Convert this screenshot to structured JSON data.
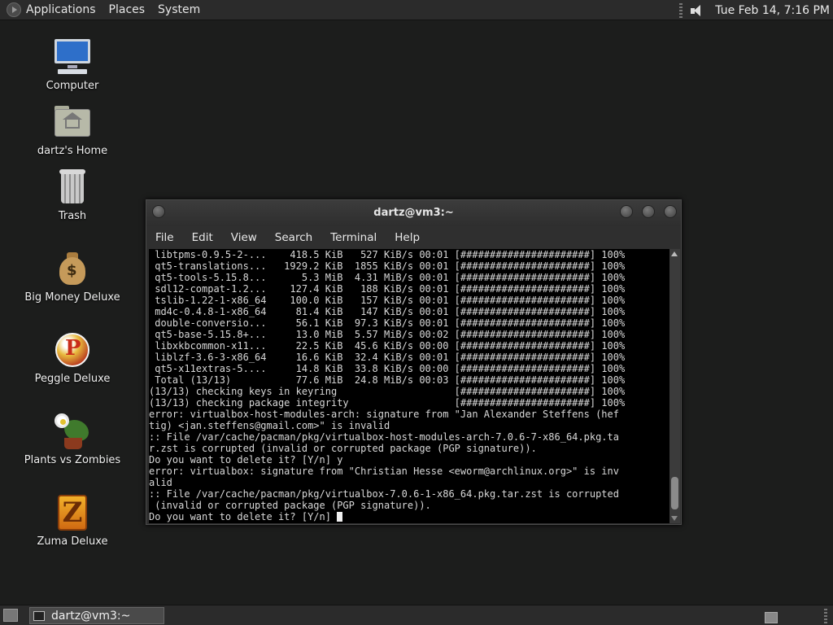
{
  "top_panel": {
    "menus": [
      "Applications",
      "Places",
      "System"
    ],
    "clock": "Tue Feb 14,  7:16 PM"
  },
  "desktop": {
    "icons": [
      {
        "label": "Computer",
        "icon": "computer-icon"
      },
      {
        "label": "dartz's Home",
        "icon": "home-folder-icon"
      },
      {
        "label": "Trash",
        "icon": "trash-icon"
      },
      {
        "label": "Big Money Deluxe",
        "icon": "money-bag-icon"
      },
      {
        "label": "Peggle Deluxe",
        "icon": "peggle-icon"
      },
      {
        "label": "Plants vs Zombies",
        "icon": "plants-icon"
      },
      {
        "label": "Zuma Deluxe",
        "icon": "zuma-icon"
      }
    ]
  },
  "terminal": {
    "title": "dartz@vm3:~",
    "menu": [
      "File",
      "Edit",
      "View",
      "Search",
      "Terminal",
      "Help"
    ],
    "lines": [
      " libtpms-0.9.5-2-...    418.5 KiB   527 KiB/s 00:01 [######################] 100%",
      " qt5-translations...   1929.2 KiB  1855 KiB/s 00:01 [######################] 100%",
      " qt5-tools-5.15.8...      5.3 MiB  4.31 MiB/s 00:01 [######################] 100%",
      " sdl12-compat-1.2...    127.4 KiB   188 KiB/s 00:01 [######################] 100%",
      " tslib-1.22-1-x86_64    100.0 KiB   157 KiB/s 00:01 [######################] 100%",
      " md4c-0.4.8-1-x86_64     81.4 KiB   147 KiB/s 00:01 [######################] 100%",
      " double-conversio...     56.1 KiB  97.3 KiB/s 00:01 [######################] 100%",
      " qt5-base-5.15.8+...     13.0 MiB  5.57 MiB/s 00:02 [######################] 100%",
      " libxkbcommon-x11...     22.5 KiB  45.6 KiB/s 00:00 [######################] 100%",
      " liblzf-3.6-3-x86_64     16.6 KiB  32.4 KiB/s 00:01 [######################] 100%",
      " qt5-x11extras-5....     14.8 KiB  33.8 KiB/s 00:00 [######################] 100%",
      " Total (13/13)           77.6 MiB  24.8 MiB/s 00:03 [######################] 100%",
      "(13/13) checking keys in keyring                    [######################] 100%",
      "(13/13) checking package integrity                  [######################] 100%",
      "error: virtualbox-host-modules-arch: signature from \"Jan Alexander Steffens (hef",
      "tig) <jan.steffens@gmail.com>\" is invalid",
      ":: File /var/cache/pacman/pkg/virtualbox-host-modules-arch-7.0.6-7-x86_64.pkg.ta",
      "r.zst is corrupted (invalid or corrupted package (PGP signature)).",
      "Do you want to delete it? [Y/n] y",
      "error: virtualbox: signature from \"Christian Hesse <eworm@archlinux.org>\" is inv",
      "alid",
      ":: File /var/cache/pacman/pkg/virtualbox-7.0.6-1-x86_64.pkg.tar.zst is corrupted",
      " (invalid or corrupted package (PGP signature)).",
      "Do you want to delete it? [Y/n] "
    ]
  },
  "taskbar": {
    "task_label": "dartz@vm3:~"
  }
}
